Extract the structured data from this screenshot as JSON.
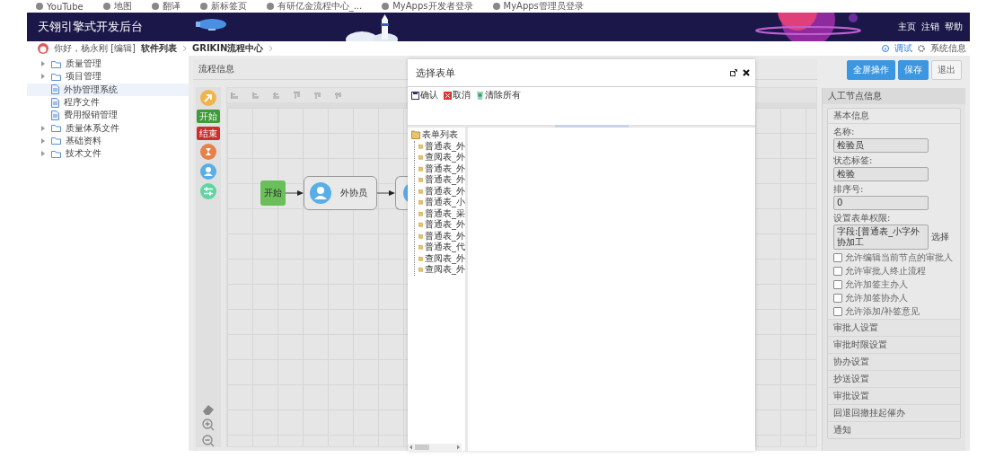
{
  "bookmarks": [
    "YouTube",
    "地图",
    "翻译",
    "新标签页",
    "有研亿金流程中心_...",
    "MyApps开发者登录",
    "MyApps管理员登录"
  ],
  "header": {
    "title": "天翎引擎式开发后台",
    "links": [
      "主页",
      "注销",
      "帮助"
    ]
  },
  "breadcrumb": {
    "greeting": "你好，杨永刚 [编辑]",
    "path": [
      "软件列表",
      "GRIKIN流程中心"
    ],
    "links": [
      {
        "kind": "info",
        "label": "调试"
      },
      {
        "kind": "gear",
        "label": "系统信息"
      }
    ]
  },
  "sidebar": {
    "items": [
      {
        "kind": "folder",
        "label": "质量管理",
        "expanded": false,
        "selected": false
      },
      {
        "kind": "folder",
        "label": "项目管理",
        "expanded": false,
        "selected": false
      },
      {
        "kind": "file",
        "label": "外协管理系统",
        "selected": true
      },
      {
        "kind": "file",
        "label": "程序文件",
        "selected": false
      },
      {
        "kind": "file",
        "label": "费用报销管理",
        "selected": false
      },
      {
        "kind": "folder",
        "label": "质量体系文件",
        "expanded": false,
        "selected": false
      },
      {
        "kind": "folder",
        "label": "基础资料",
        "expanded": false,
        "selected": false
      },
      {
        "kind": "folder",
        "label": "技术文件",
        "expanded": false,
        "selected": false
      }
    ]
  },
  "flow": {
    "title": "流程信息",
    "palette": [
      {
        "kind": "arrow"
      },
      {
        "kind": "start",
        "label": "开始"
      },
      {
        "kind": "end",
        "label": "结束"
      },
      {
        "kind": "auto"
      },
      {
        "kind": "manual"
      },
      {
        "kind": "branch"
      }
    ],
    "nodes": [
      {
        "kind": "start",
        "label": "开始"
      },
      {
        "kind": "manual",
        "label": "外协员"
      },
      {
        "kind": "manual"
      }
    ]
  },
  "actions": [
    {
      "kind": "primary",
      "label": "全屏操作"
    },
    {
      "kind": "primary",
      "label": "保存"
    },
    {
      "kind": "default",
      "label": "退出"
    }
  ],
  "dialog": {
    "title": "选择表单",
    "tools": [
      {
        "kind": "confirm",
        "label": "确认"
      },
      {
        "kind": "cancel",
        "label": "取消"
      },
      {
        "kind": "clear",
        "label": "清除所有"
      }
    ],
    "tree": {
      "label": "表单列表",
      "children": [
        {
          "label": "普通表_外"
        },
        {
          "label": "查阅表_外"
        },
        {
          "label": "普通表_外"
        },
        {
          "label": "普通表_外"
        },
        {
          "label": "普通表_外"
        },
        {
          "label": "普通表_小"
        },
        {
          "label": "普通表_采"
        },
        {
          "label": "普通表_外"
        },
        {
          "label": "普通表_外"
        },
        {
          "label": "普通表_代"
        },
        {
          "label": "查阅表_外"
        },
        {
          "label": "查阅表_外"
        }
      ]
    }
  },
  "node_panel": {
    "title": "人工节点信息",
    "group": "基本信息",
    "fields": [
      {
        "label": "名称:",
        "value": "检验员"
      },
      {
        "label": "状态标签:",
        "value": "检验"
      },
      {
        "label": "排序号:",
        "value": "0"
      },
      {
        "label": "设置表单权限:",
        "value": "字段:[普通表_小字外协加工",
        "link": "选择"
      }
    ],
    "options": [
      {
        "label": "允许编辑当前节点的审批人",
        "checked": false
      },
      {
        "label": "允许审批人终止流程",
        "checked": false
      },
      {
        "label": "允许加签主办人",
        "checked": false
      },
      {
        "label": "允许加签协办人",
        "checked": false
      },
      {
        "label": "允许添加/补签意见",
        "checked": false
      }
    ],
    "sections": [
      "审批人设置",
      "审批时限设置",
      "协办设置",
      "抄送设置",
      "审批设置",
      "回退回撤挂起催办",
      "通知"
    ]
  }
}
